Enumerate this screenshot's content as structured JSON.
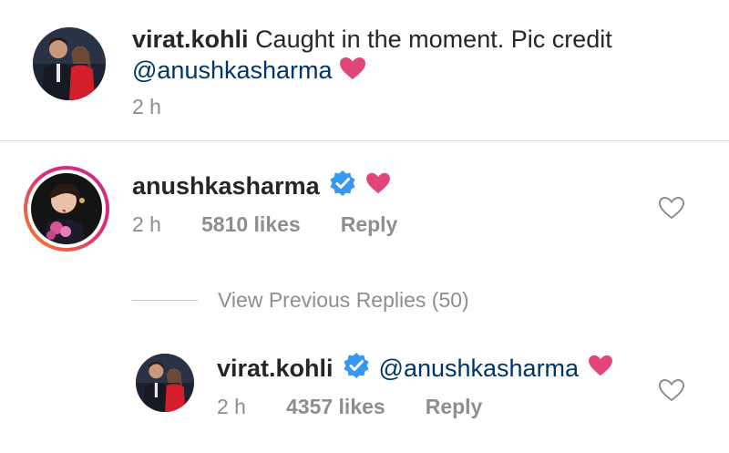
{
  "post": {
    "username": "virat.kohli",
    "caption": "Caught in the moment. Pic credit",
    "mention": "@anushkasharma",
    "time": "2 h"
  },
  "comment": {
    "username": "anushkasharma",
    "verified": true,
    "time": "2 h",
    "likes": "5810 likes",
    "reply": "Reply"
  },
  "view_previous": "View Previous Replies (50)",
  "reply": {
    "username": "virat.kohli",
    "verified": true,
    "mention": "@anushkasharma",
    "time": "2 h",
    "likes": "4357 likes",
    "reply": "Reply"
  },
  "colors": {
    "heart_emoji": "#e0457b",
    "verified_badge": "#3897f0",
    "mention": "#003569",
    "meta_gray": "#8e8e8e",
    "story_ring_start": "#f58529",
    "story_ring_end": "#dd2a7b"
  },
  "icons": {
    "heart_emoji": "heart-emoji-icon",
    "verified": "verified-badge-icon",
    "like": "heart-outline-icon"
  }
}
